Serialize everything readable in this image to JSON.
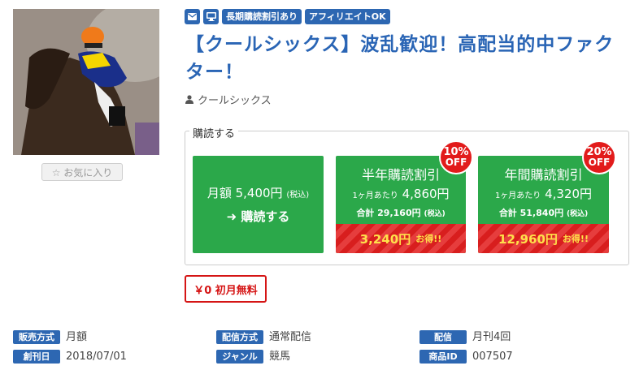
{
  "product": {
    "image_alt": "競馬の騎手",
    "favorite_label": "お気に入り",
    "tags": [
      "長期購読割引あり",
      "アフィリエイトOK"
    ],
    "title": "【クールシックス】波乱歓迎！高配当的中ファクター！",
    "author": "クールシックス"
  },
  "subscribe": {
    "legend": "購読する",
    "monthly": {
      "price": "月額 5,400円",
      "tax": "(税込)",
      "cta": "購読する"
    },
    "half_year": {
      "name": "半年購読割引",
      "per_month_label": "1ヶ月あたり",
      "per_month": "4,860円",
      "total_label": "合計",
      "total": "29,160円",
      "tax": "(税込)",
      "savings": "3,240円",
      "otoku": "お得!!",
      "badge_pct": "10%",
      "badge_off": "OFF"
    },
    "year": {
      "name": "年間購読割引",
      "per_month_label": "1ヶ月あたり",
      "per_month": "4,320円",
      "total_label": "合計",
      "total": "51,840円",
      "tax": "(税込)",
      "savings": "12,960円",
      "otoku": "お得!!",
      "badge_pct": "20%",
      "badge_off": "OFF"
    },
    "first_month_free": "￥0 初月無料"
  },
  "meta": [
    {
      "label": "販売方式",
      "value": "月額"
    },
    {
      "label": "配信方式",
      "value": "通常配信"
    },
    {
      "label": "配信",
      "value": "月刊4回"
    },
    {
      "label": "創刊日",
      "value": "2018/07/01"
    },
    {
      "label": "ジャンル",
      "value": "競馬"
    },
    {
      "label": "商品ID",
      "value": "007507"
    }
  ],
  "colors": {
    "brand": "#2d67b2",
    "title": "#2a65b5",
    "plan_green": "#2ba84a",
    "badge_red": "#e21b1b",
    "savings_yellow": "#ffe04a"
  },
  "icons": [
    "mail-icon",
    "monitor-icon",
    "user-icon",
    "star-outline-icon",
    "arrow-right-icon"
  ]
}
